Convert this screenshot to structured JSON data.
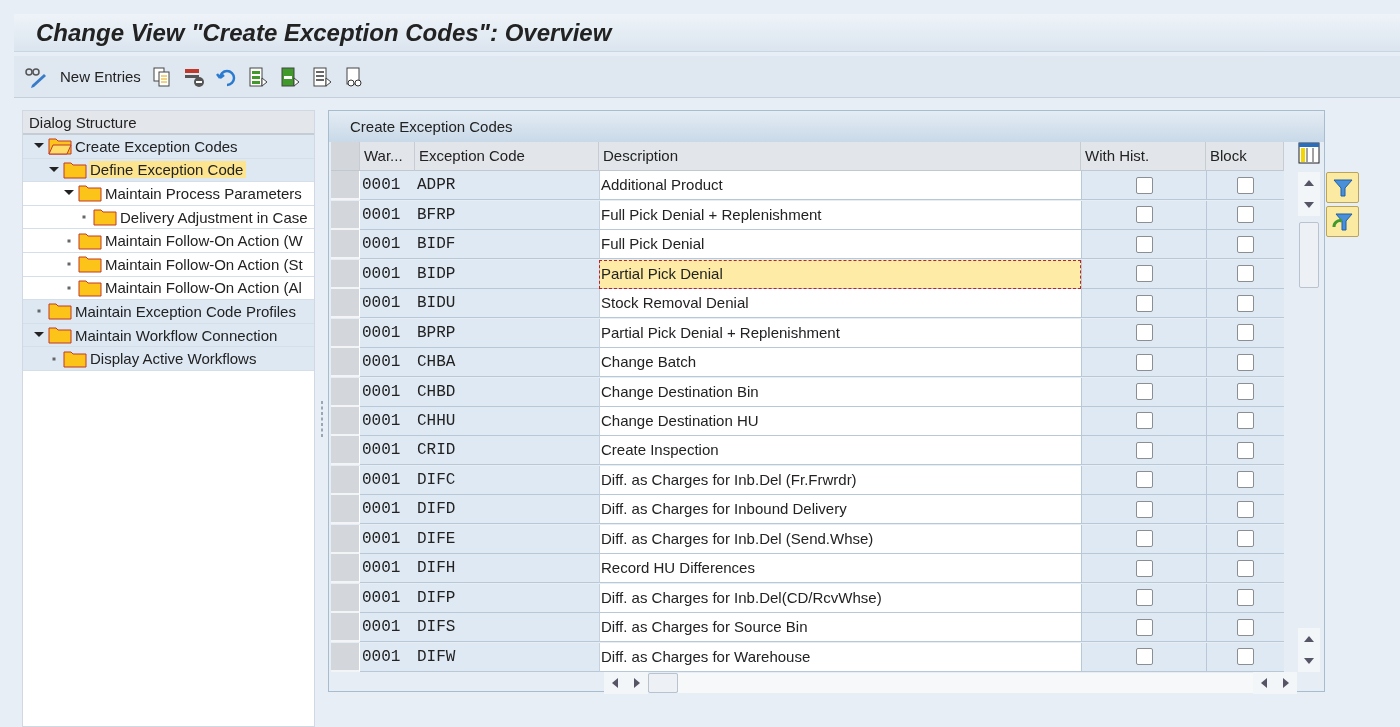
{
  "window": {
    "title": "Change View \"Create Exception Codes\": Overview"
  },
  "toolbar": {
    "new_entries": "New Entries"
  },
  "dialog_structure": {
    "title": "Dialog Structure",
    "items": [
      {
        "label": "Create Exception Codes",
        "expanded": true,
        "selected": false,
        "children": [
          {
            "label": "Define Exception Code",
            "expanded": true,
            "selected": true,
            "children": [
              {
                "label": "Maintain Process Parameters",
                "expanded": true,
                "selected": false,
                "children": [
                  {
                    "label": "Delivery Adjustment in Case",
                    "selected": false
                  }
                ]
              },
              {
                "label": "Maintain Follow-On Action (W",
                "selected": false
              },
              {
                "label": "Maintain Follow-On Action (St",
                "selected": false
              },
              {
                "label": "Maintain Follow-On Action (Al",
                "selected": false
              }
            ]
          }
        ]
      },
      {
        "label": "Maintain Exception Code Profiles",
        "selected": false
      },
      {
        "label": "Maintain Workflow Connection",
        "expanded": true,
        "selected": false,
        "children": [
          {
            "label": "Display Active Workflows",
            "selected": false
          }
        ]
      }
    ]
  },
  "table": {
    "title": "Create Exception Codes",
    "columns": [
      "War...",
      "Exception Code",
      "Description",
      "With Hist.",
      "Block"
    ],
    "rows": [
      {
        "warehouse": "0001",
        "code": "ADPR",
        "description": "Additional Product",
        "with_hist": false,
        "block": false,
        "focused": false
      },
      {
        "warehouse": "0001",
        "code": "BFRP",
        "description": "Full Pick Denial + Replenishment",
        "with_hist": false,
        "block": false,
        "focused": false
      },
      {
        "warehouse": "0001",
        "code": "BIDF",
        "description": "Full Pick Denial",
        "with_hist": false,
        "block": false,
        "focused": false
      },
      {
        "warehouse": "0001",
        "code": "BIDP",
        "description": "Partial Pick Denial",
        "with_hist": false,
        "block": false,
        "focused": true
      },
      {
        "warehouse": "0001",
        "code": "BIDU",
        "description": "Stock Removal Denial",
        "with_hist": false,
        "block": false,
        "focused": false
      },
      {
        "warehouse": "0001",
        "code": "BPRP",
        "description": "Partial Pick Denial + Replenishment",
        "with_hist": false,
        "block": false,
        "focused": false
      },
      {
        "warehouse": "0001",
        "code": "CHBA",
        "description": "Change Batch",
        "with_hist": false,
        "block": false,
        "focused": false
      },
      {
        "warehouse": "0001",
        "code": "CHBD",
        "description": "Change Destination Bin",
        "with_hist": false,
        "block": false,
        "focused": false
      },
      {
        "warehouse": "0001",
        "code": "CHHU",
        "description": "Change Destination HU",
        "with_hist": false,
        "block": false,
        "focused": false
      },
      {
        "warehouse": "0001",
        "code": "CRID",
        "description": "Create Inspection",
        "with_hist": false,
        "block": false,
        "focused": false
      },
      {
        "warehouse": "0001",
        "code": "DIFC",
        "description": "Diff. as Charges for Inb.Del (Fr.Frwrdr)",
        "with_hist": false,
        "block": false,
        "focused": false
      },
      {
        "warehouse": "0001",
        "code": "DIFD",
        "description": "Diff. as Charges for Inbound Delivery",
        "with_hist": false,
        "block": false,
        "focused": false
      },
      {
        "warehouse": "0001",
        "code": "DIFE",
        "description": "Diff. as Charges for Inb.Del (Send.Whse)",
        "with_hist": false,
        "block": false,
        "focused": false
      },
      {
        "warehouse": "0001",
        "code": "DIFH",
        "description": "Record HU Differences",
        "with_hist": false,
        "block": false,
        "focused": false
      },
      {
        "warehouse": "0001",
        "code": "DIFP",
        "description": "Diff. as Charges for Inb.Del(CD/RcvWhse)",
        "with_hist": false,
        "block": false,
        "focused": false
      },
      {
        "warehouse": "0001",
        "code": "DIFS",
        "description": "Diff. as Charges for Source Bin",
        "with_hist": false,
        "block": false,
        "focused": false
      },
      {
        "warehouse": "0001",
        "code": "DIFW",
        "description": "Diff. as Charges for Warehouse",
        "with_hist": false,
        "block": false,
        "focused": false
      }
    ]
  }
}
